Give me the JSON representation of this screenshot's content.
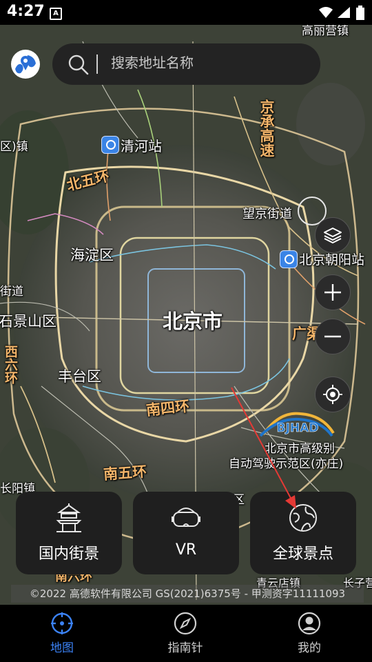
{
  "status_bar": {
    "time": "4:27",
    "notification": "A"
  },
  "search": {
    "placeholder": "搜索地址名称"
  },
  "map_labels": {
    "city": "北京市",
    "haidian": "海淀区",
    "fengtai": "丰台区",
    "shijingshan": "石景山区",
    "ring5_north": "北五环",
    "ring4_south": "南四环",
    "ring5_south": "南五环",
    "ring6_south": "南六环",
    "jingcheng": "京承高速",
    "guangqu": "广渠路",
    "wangjing": "望京街道",
    "qinghe_station": "清河站",
    "chaoyang_station": "北京朝阳站",
    "zone_line1": "北京市高级别",
    "zone_line2": "自动驾驶示范区(亦庄)",
    "bjhad": "BJHAD",
    "top_road": "高丽营镇",
    "left_town": "区)镇",
    "left_street": "街道",
    "changyang": "长阳镇",
    "xihongmen": "南四环",
    "qingyun": "青云店镇",
    "changzi": "长子营",
    "dist_lbl": "区",
    "west_ring": "西六环"
  },
  "controls": {
    "layers": "layers-icon",
    "zoom_in": "plus-icon",
    "zoom_out": "minus-icon",
    "locate": "locate-icon"
  },
  "features": [
    {
      "label": "国内街景",
      "icon": "pagoda-icon"
    },
    {
      "label": "VR",
      "icon": "vr-headset-icon"
    },
    {
      "label": "全球景点",
      "icon": "globe-icon"
    }
  ],
  "copyright": "©2022 高德软件有限公司 GS(2021)6375号 - 甲测资字11111093",
  "nav": [
    {
      "label": "地图",
      "active": true
    },
    {
      "label": "指南针",
      "active": false
    },
    {
      "label": "我的",
      "active": false
    }
  ],
  "colors": {
    "accent": "#3b82f6",
    "road_label": "#f3b56a",
    "arrow": "#e53935"
  }
}
